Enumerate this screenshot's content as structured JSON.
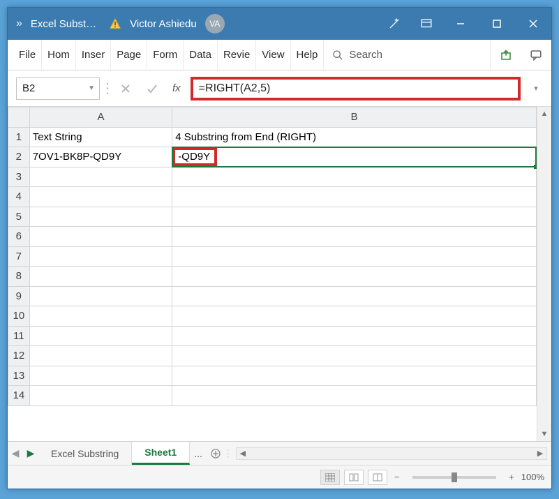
{
  "titlebar": {
    "doc_title": "Excel Subst…",
    "user_name": "Victor Ashiedu",
    "user_initials": "VA"
  },
  "menu": {
    "file": "File",
    "home": "Hom",
    "insert": "Inser",
    "page": "Page",
    "formulas": "Form",
    "data": "Data",
    "review": "Revie",
    "view": "View",
    "help": "Help",
    "search": "Search"
  },
  "formula_bar": {
    "name_box": "B2",
    "fx_label": "fx",
    "formula": "=RIGHT(A2,5)"
  },
  "columns": {
    "a": "A",
    "b": "B"
  },
  "rows": [
    "1",
    "2",
    "3",
    "4",
    "5",
    "6",
    "7",
    "8",
    "9",
    "10",
    "11",
    "12",
    "13",
    "14"
  ],
  "cells": {
    "A1": "Text String",
    "B1": "4 Substring from End (RIGHT)",
    "A2": "7OV1-BK8P-QD9Y",
    "B2": "-QD9Y"
  },
  "sheet_tabs": {
    "tab1": "Excel Substring",
    "tab2": "Sheet1",
    "overflow": "..."
  },
  "status": {
    "zoom": "100%"
  },
  "chart_data": {
    "type": "table",
    "headers": [
      "Text String",
      "4 Substring from End (RIGHT)"
    ],
    "rows": [
      [
        "7OV1-BK8P-QD9Y",
        "-QD9Y"
      ]
    ],
    "formula_cell": "B2",
    "formula": "=RIGHT(A2,5)"
  }
}
